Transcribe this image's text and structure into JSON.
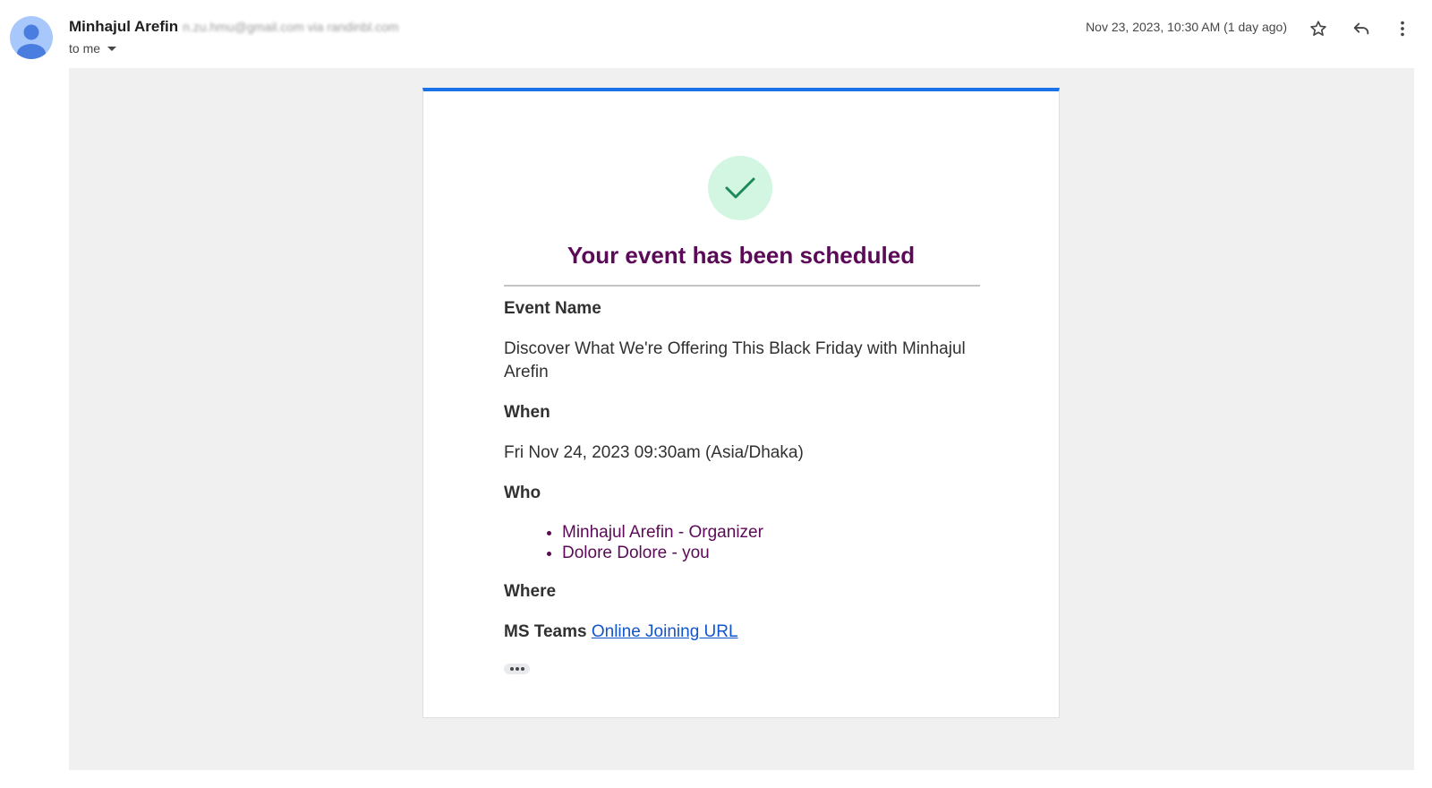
{
  "header": {
    "sender_name": "Minhajul Arefin",
    "sender_email": "n.zu.hmu@gmail.com via randinbl.com",
    "to_label": "to me",
    "date": "Nov 23, 2023, 10:30 AM (1 day ago)",
    "icons": [
      "avatar",
      "star-icon",
      "reply-icon",
      "more-vert-icon",
      "chevron-down-icon"
    ]
  },
  "card": {
    "accent_color": "#1a73e8",
    "title": "Your event has been scheduled",
    "title_color": "#5b0a57",
    "event_name_label": "Event Name",
    "event_name": "Discover What We're Offering This Black Friday with Minhajul Arefin",
    "when_label": "When",
    "when": "Fri Nov 24, 2023 09:30am (Asia/Dhaka)",
    "who_label": "Who",
    "who": [
      "Minhajul Arefin - Organizer",
      "Dolore Dolore - you"
    ],
    "where_label": "Where",
    "where_platform": "MS Teams",
    "where_link": "Online Joining URL"
  }
}
